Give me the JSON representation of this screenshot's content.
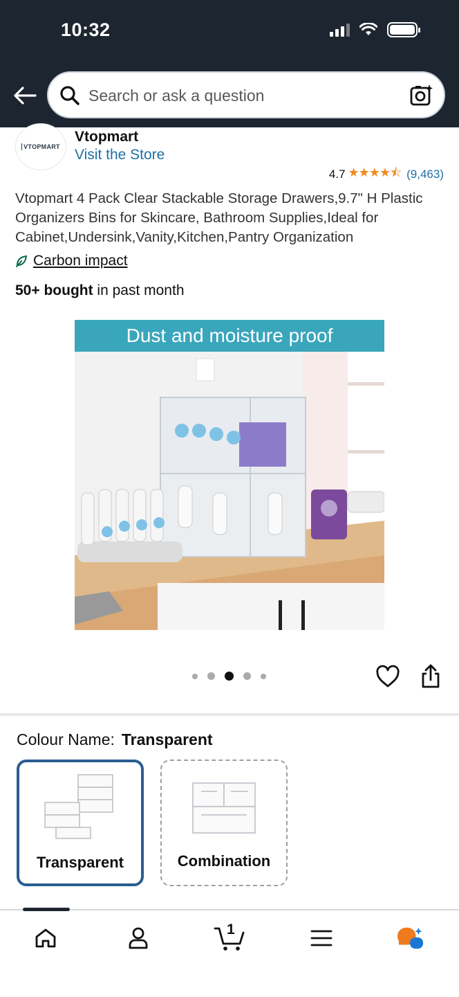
{
  "status_bar": {
    "time": "10:32"
  },
  "header": {
    "search_placeholder": "Search or ask a question"
  },
  "brand": {
    "logo_text": "VTOPMART",
    "name": "Vtopmart",
    "store_link": "Visit the Store"
  },
  "rating": {
    "value": "4.7",
    "stars": "★★★★⯪",
    "count": "(9,463)"
  },
  "product": {
    "title": "Vtopmart 4 Pack Clear Stackable Storage Drawers,9.7\" H Plastic Organizers Bins for Skincare, Bathroom Supplies,Ideal for Cabinet,Undersink,Vanity,Kitchen,Pantry Organization",
    "carbon_link": "Carbon impact",
    "bought_bold": "50+ bought",
    "bought_rest": " in past month",
    "image_banner": "Dust and moisture proof"
  },
  "carousel": {
    "total": 5,
    "active_index": 2
  },
  "colour": {
    "label": "Colour Name:",
    "selected": "Transparent",
    "options": [
      {
        "label": "Transparent"
      },
      {
        "label": "Combination"
      }
    ]
  },
  "bottom_nav": {
    "cart_count": "1"
  },
  "colors": {
    "header_bg": "#1d2630",
    "link": "#1f6fa3",
    "star": "#f08a1c",
    "banner": "#3aa6bc",
    "selected_border": "#2a5d8f"
  }
}
